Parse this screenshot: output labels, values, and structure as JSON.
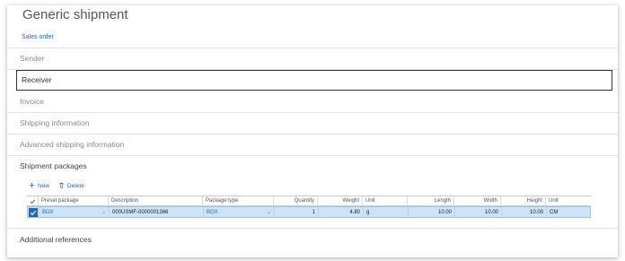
{
  "page": {
    "title": "Generic shipment",
    "link": "Sales order"
  },
  "sections": {
    "sender": "Sender",
    "receiver": "Receiver",
    "invoice": "Invoice",
    "shipping_information": "Shipping information",
    "advanced_shipping_information": "Advanced shipping information",
    "shipment_packages": "Shipment packages",
    "additional_references": "Additional references"
  },
  "toolbar": {
    "new_label": "New",
    "delete_label": "Delete"
  },
  "grid": {
    "columns": [
      "Preset package",
      "Description",
      "Package type",
      "Quantity",
      "Weight",
      "Unit",
      "Length",
      "Width",
      "Height",
      "Unit"
    ],
    "rows": [
      [
        "BOX",
        "000USMF-0000001366",
        "BOX",
        "1",
        "4.80",
        "g",
        "10.00",
        "10.00",
        "10.00",
        "CM"
      ]
    ]
  },
  "colors": {
    "accent": "#2266bb",
    "row_selected": "#cde3f7"
  }
}
